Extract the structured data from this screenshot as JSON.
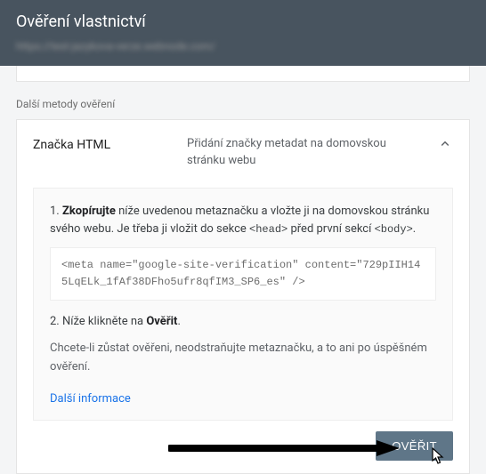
{
  "header": {
    "title": "Ověření vlastnictví",
    "subtitle": "https://test-jazykova-verze.webnode.com/"
  },
  "section_label": "Další metody ověření",
  "accordion": {
    "title": "Značka HTML",
    "description": "Přidání značky metadat na domovskou stránku webu"
  },
  "panel": {
    "step1_pre": "1. ",
    "step1_bold": "Zkopírujte",
    "step1_post": " níže uvedenou metaznačku a vložte ji na domovskou stránku svého webu. Je třeba ji vložit do sekce ",
    "step1_code1": "<head>",
    "step1_mid": " před první sekcí ",
    "step1_code2": "<body>",
    "step1_end": ".",
    "code": "<meta name=\"google-site-verification\" content=\"729pIIH145LqELk_1fAf38DFho5ufr8qfIM3_SP6_es\" />",
    "step2_pre": "2. Níže klikněte na ",
    "step2_bold": "Ověřit",
    "step2_end": ".",
    "note": "Chcete-li zůstat ověřeni, neodstraňujte metaznačku, a to ani po úspěšném ověření.",
    "more_link": "Další informace"
  },
  "footer": {
    "verify_btn": "OVĚŘIT"
  }
}
